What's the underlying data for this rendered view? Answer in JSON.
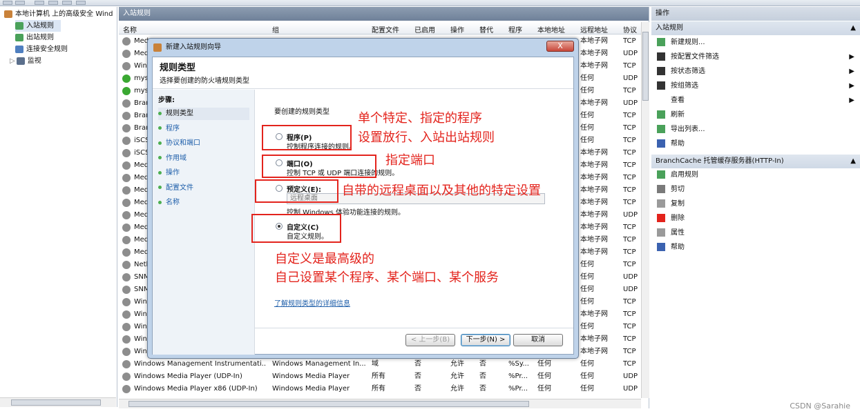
{
  "tree": {
    "root": "本地计算机 上的高级安全 Wind",
    "items": [
      "入站规则",
      "出站规则",
      "连接安全规则",
      "监视"
    ]
  },
  "center": {
    "title": "入站规则",
    "columns": [
      "名称",
      "组",
      "配置文件",
      "已启用",
      "操作",
      "替代",
      "程序",
      "本地地址",
      "远程地址",
      "协议"
    ],
    "top_rows": [
      {
        "name": "Med",
        "remote": "本地子网",
        "proto": "TCP"
      },
      {
        "name": "Med",
        "remote": "本地子网",
        "proto": "UDP"
      },
      {
        "name": "Wind",
        "remote": "本地子网",
        "proto": "TCP"
      },
      {
        "name": "mysc",
        "remote": "任何",
        "proto": "UDP",
        "ok": true
      },
      {
        "name": "mysc",
        "remote": "任何",
        "proto": "TCP",
        "ok": true
      },
      {
        "name": "Bran",
        "remote": "本地子网",
        "proto": "UDP"
      },
      {
        "name": "Bran",
        "remote": "任何",
        "proto": "TCP"
      },
      {
        "name": "Bran",
        "remote": "任何",
        "proto": "TCP"
      },
      {
        "name": "iSCSI",
        "remote": "任何",
        "proto": "TCP"
      },
      {
        "name": "iSCSI",
        "remote": "本地子网",
        "proto": "TCP"
      },
      {
        "name": "Med",
        "remote": "本地子网",
        "proto": "TCP"
      },
      {
        "name": "Med",
        "remote": "本地子网",
        "proto": "TCP"
      },
      {
        "name": "Med",
        "remote": "本地子网",
        "proto": "TCP"
      },
      {
        "name": "Med",
        "remote": "本地子网",
        "proto": "TCP"
      },
      {
        "name": "Med",
        "remote": "本地子网",
        "proto": "UDP"
      },
      {
        "name": "Med",
        "remote": "本地子网",
        "proto": "TCP"
      },
      {
        "name": "Med",
        "remote": "本地子网",
        "proto": "TCP"
      },
      {
        "name": "Med",
        "remote": "本地子网",
        "proto": "TCP"
      },
      {
        "name": "Netl",
        "remote": "任何",
        "proto": "TCP"
      },
      {
        "name": "SNM",
        "remote": "任何",
        "proto": "UDP"
      },
      {
        "name": "SNM",
        "remote": "任何",
        "proto": "UDP"
      },
      {
        "name": "Wind",
        "remote": "任何",
        "proto": "TCP"
      },
      {
        "name": "Wind",
        "remote": "本地子网",
        "proto": "TCP"
      },
      {
        "name": "Wind",
        "remote": "任何",
        "proto": "TCP"
      },
      {
        "name": "Wind",
        "remote": "本地子网",
        "proto": "TCP"
      },
      {
        "name": "Wind",
        "remote": "本地子网",
        "proto": "TCP"
      }
    ],
    "bottom_rows": [
      {
        "name": "Windows Management Instrumentati...",
        "group": "Windows Management In...",
        "profile": "域",
        "enabled": "否",
        "action": "允许",
        "override": "否",
        "program": "%Sy...",
        "local": "任何",
        "remote": "任何",
        "proto": "TCP"
      },
      {
        "name": "Windows Media Player (UDP-In)",
        "group": "Windows Media Player",
        "profile": "所有",
        "enabled": "否",
        "action": "允许",
        "override": "否",
        "program": "%Pr...",
        "local": "任何",
        "remote": "任何",
        "proto": "UDP"
      },
      {
        "name": "Windows Media Player x86 (UDP-In)",
        "group": "Windows Media Player",
        "profile": "所有",
        "enabled": "否",
        "action": "允许",
        "override": "否",
        "program": "%Pr...",
        "local": "任何",
        "remote": "任何",
        "proto": "UDP"
      }
    ]
  },
  "actions": {
    "header": "操作",
    "section1": "入站规则",
    "items1": [
      "新建规则...",
      "按配置文件筛选",
      "按状态筛选",
      "按组筛选",
      "查看",
      "刷新",
      "导出列表...",
      "帮助"
    ],
    "section2": "BranchCache 托管缓存服务器(HTTP-In)",
    "items2": [
      "启用规则",
      "剪切",
      "复制",
      "删除",
      "属性",
      "帮助"
    ]
  },
  "dialog": {
    "title": "新建入站规则向导",
    "close": "X",
    "heading": "规则类型",
    "subheading": "选择要创建的防火墙规则类型",
    "steps_label": "步骤:",
    "steps": [
      "规则类型",
      "程序",
      "协议和端口",
      "作用域",
      "操作",
      "配置文件",
      "名称"
    ],
    "question": "要创建的规则类型",
    "options": [
      {
        "title": "程序(P)",
        "desc": "控制程序连接的规则。"
      },
      {
        "title": "端口(O)",
        "desc": "控制 TCP 或 UDP 端口连接的规则。"
      },
      {
        "title": "预定义(E):",
        "desc": "控制 Windows 体验功能连接的规则。"
      },
      {
        "title": "自定义(C)",
        "desc": "自定义规则。"
      }
    ],
    "predefined_value": "远程桌面",
    "help_link": "了解规则类型的详细信息",
    "buttons": {
      "back": "< 上一步(B)",
      "next": "下一步(N) >",
      "cancel": "取消"
    }
  },
  "annotations": {
    "a1": "单个特定、指定的程序",
    "a2": "设置放行、入站出站规则",
    "a3": "指定端口",
    "a4": "自带的远程桌面以及其他的特定设置",
    "a5": "自定义是最高级的",
    "a6": "自己设置某个程序、某个端口、某个服务"
  },
  "watermark": "CSDN @Sarahie"
}
